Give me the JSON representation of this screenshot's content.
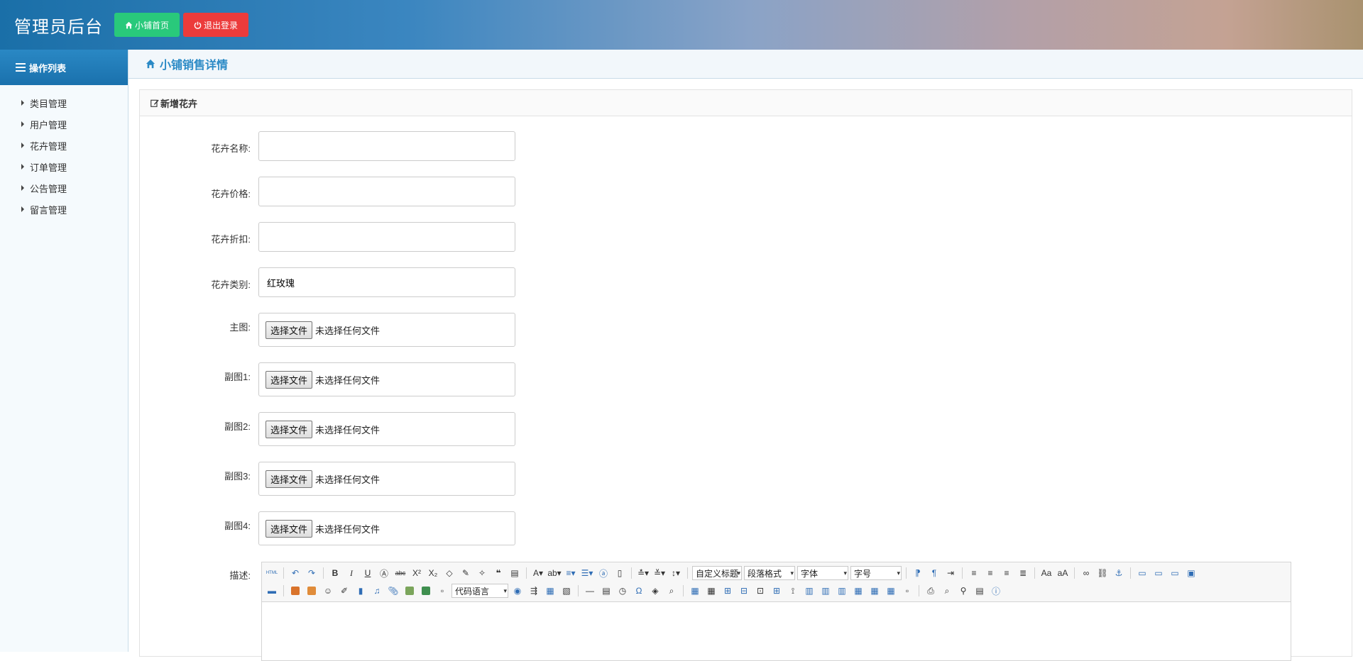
{
  "header": {
    "title": "管理员后台",
    "home_button": "小铺首页",
    "logout_button": "退出登录"
  },
  "sidebar": {
    "title": "操作列表",
    "items": [
      {
        "label": "类目管理"
      },
      {
        "label": "用户管理"
      },
      {
        "label": "花卉管理"
      },
      {
        "label": "订单管理"
      },
      {
        "label": "公告管理"
      },
      {
        "label": "留言管理"
      }
    ]
  },
  "breadcrumb": {
    "title": "小铺销售详情"
  },
  "panel": {
    "title": "新增花卉"
  },
  "form": {
    "name_label": "花卉名称:",
    "name_value": "",
    "price_label": "花卉价格:",
    "price_value": "",
    "discount_label": "花卉折扣:",
    "discount_value": "",
    "category_label": "花卉类别:",
    "category_value": "红玫瑰",
    "main_image_label": "主图:",
    "sub1_label": "副图1:",
    "sub2_label": "副图2:",
    "sub3_label": "副图3:",
    "sub4_label": "副图4:",
    "file_button": "选择文件",
    "file_status": "未选择任何文件",
    "desc_label": "描述:"
  },
  "editor": {
    "html_label": "HTML",
    "title_select": "自定义标题",
    "paragraph_select": "段落格式",
    "font_select": "字体",
    "size_select": "字号",
    "code_select": "代码语言"
  },
  "colors": {
    "accent": "#2b8ac6",
    "home_button": "#29c97b",
    "logout_button": "#ec3b3b"
  }
}
